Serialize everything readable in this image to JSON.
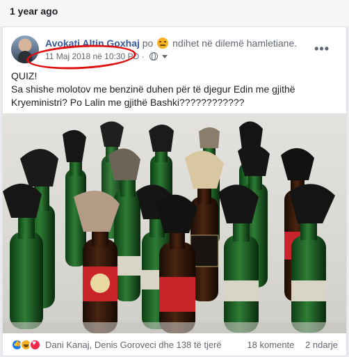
{
  "memory": {
    "label": "1 year ago"
  },
  "post": {
    "author": "Avokati Altin Goxhaj",
    "feeling_prefix": "po",
    "feeling": "ndihet në dilemë hamletiane.",
    "feeling_icon": "confused-face-icon",
    "date": "11 Maj 2018 në 10:30 PD",
    "audience_icon": "globe-icon",
    "highlight_color": "#e01010",
    "text": "QUIZ!\nSa shishe molotov me benzinë duhen për të djegur Edin me gjithë Kryeministri? Po Lalin me gjithë Bashki????????????",
    "photo_icon": "molotov-bottles-photo"
  },
  "footer": {
    "reactions": [
      "like-icon",
      "haha-icon",
      "love-icon"
    ],
    "reactors": "Dani Kanaj, Denis Goroveci dhe 138 të tjerë",
    "comments": "18 komente",
    "shares": "2 ndarje"
  },
  "colors": {
    "link": "#385898",
    "meta": "#606770",
    "background": "#e9ebee"
  }
}
